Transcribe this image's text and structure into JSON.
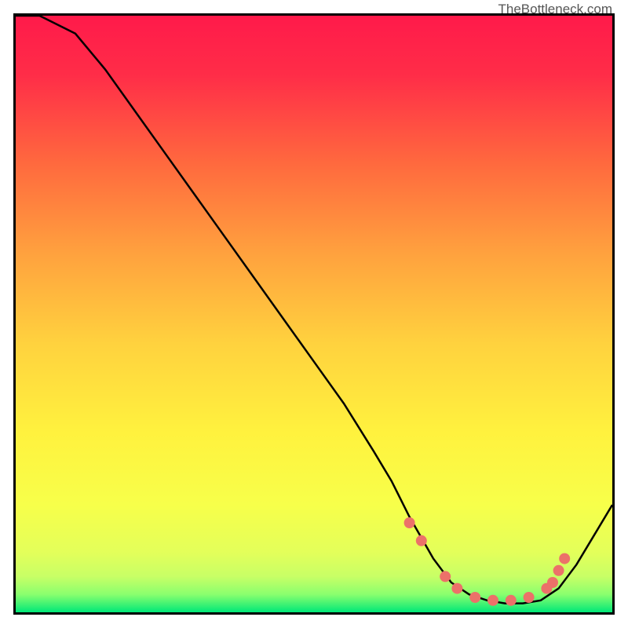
{
  "watermark": "TheBottleneck.com",
  "chart_data": {
    "type": "line",
    "title": "",
    "xlabel": "",
    "ylabel": "",
    "xlim": [
      0,
      100
    ],
    "ylim": [
      0,
      100
    ],
    "grid": false,
    "background": "gradient",
    "gradient_colors": {
      "top": "#ff1a4a",
      "upper_mid": "#ff8b3e",
      "mid": "#ffe43e",
      "lower_mid": "#f3ff58",
      "bottom": "#00e878"
    },
    "series": [
      {
        "name": "bottleneck-curve",
        "type": "line",
        "color": "#000000",
        "x": [
          0,
          4,
          10,
          15,
          20,
          25,
          30,
          35,
          40,
          45,
          50,
          55,
          60,
          63,
          66,
          70,
          73,
          76,
          79,
          82,
          85,
          88,
          91,
          94,
          97,
          100
        ],
        "y": [
          100,
          100,
          97,
          91,
          84,
          77,
          70,
          63,
          56,
          49,
          42,
          35,
          27,
          22,
          16,
          9,
          5,
          3,
          2,
          1.5,
          1.5,
          2,
          4,
          8,
          13,
          18
        ]
      },
      {
        "name": "highlight-dots",
        "type": "scatter",
        "color": "#ec7169",
        "x": [
          66,
          68,
          72,
          74,
          77,
          80,
          83,
          86,
          89,
          90,
          91,
          92
        ],
        "y": [
          15,
          12,
          6,
          4,
          2.5,
          2,
          2,
          2.5,
          4,
          5,
          7,
          9
        ]
      }
    ]
  }
}
